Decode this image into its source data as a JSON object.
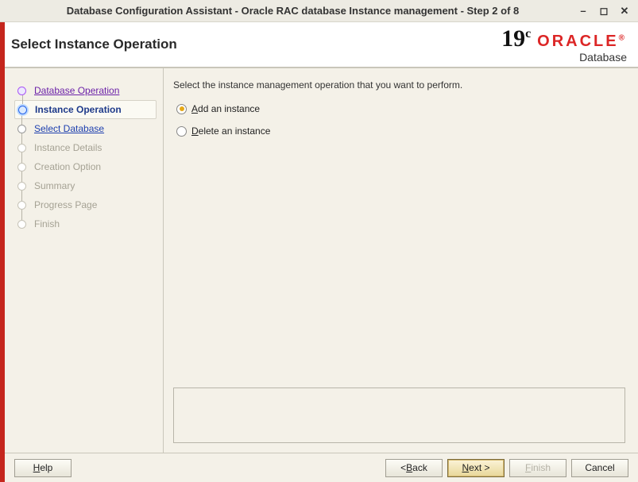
{
  "window": {
    "title": "Database Configuration Assistant - Oracle RAC database Instance management - Step 2 of 8"
  },
  "header": {
    "title": "Select Instance Operation",
    "version_main": "19",
    "version_sup": "c",
    "brand_name": "ORACLE",
    "brand_sub": "Database"
  },
  "sidebar": {
    "steps": [
      {
        "label": "Database Operation",
        "state": "done link"
      },
      {
        "label": "Instance Operation",
        "state": "current"
      },
      {
        "label": "Select Database",
        "state": "link"
      },
      {
        "label": "Instance Details",
        "state": "pending"
      },
      {
        "label": "Creation Option",
        "state": "pending"
      },
      {
        "label": "Summary",
        "state": "pending"
      },
      {
        "label": "Progress Page",
        "state": "pending"
      },
      {
        "label": "Finish",
        "state": "pending"
      }
    ]
  },
  "main": {
    "prompt": "Select the instance management operation that you want to perform.",
    "options": {
      "add": {
        "text": "Add an instance",
        "mnemonic": "A",
        "selected": true
      },
      "del": {
        "text": "Delete an instance",
        "mnemonic": "D",
        "selected": false
      }
    }
  },
  "footer": {
    "help": "Help",
    "back": "< Back",
    "next": "Next >",
    "finish": "Finish",
    "cancel": "Cancel"
  }
}
